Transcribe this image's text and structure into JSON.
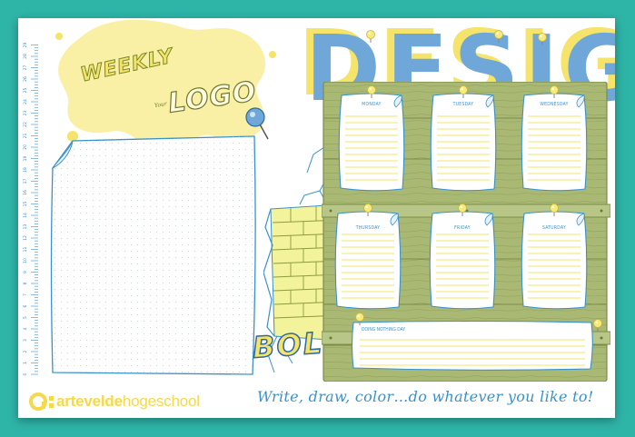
{
  "headings": {
    "weekly": "WEEKLY",
    "logo": "LOGO",
    "your": "Your",
    "design": "DESIGN",
    "bold": "BOLD"
  },
  "days": {
    "monday": "MONDAY",
    "tuesday": "TUESDAY",
    "wednesday": "WEDNESDAY",
    "thursday": "THURSDAY",
    "friday": "FRIDAY",
    "saturday": "SATURDAY",
    "sunday": "DOING NOTHING DAY"
  },
  "footer": {
    "brand_prefix": "artevelde",
    "brand_suffix": "hogeschool",
    "tagline": "Write, draw, color…do whatever you like to!"
  },
  "ruler": {
    "labels": [
      "0",
      "1",
      "2",
      "3",
      "4",
      "5",
      "6",
      "7",
      "8",
      "9",
      "10",
      "11",
      "12",
      "13",
      "14",
      "15",
      "16",
      "17",
      "18",
      "19",
      "20",
      "21",
      "22",
      "23",
      "24",
      "25",
      "26",
      "27",
      "28",
      "29"
    ]
  },
  "colors": {
    "background": "#2fb5a8",
    "paper": "#ffffff",
    "accent_yellow": "#f5e36a",
    "accent_blue": "#3a91c9",
    "wood_green": "#a9b974",
    "brick_yellow": "#eef07a"
  }
}
